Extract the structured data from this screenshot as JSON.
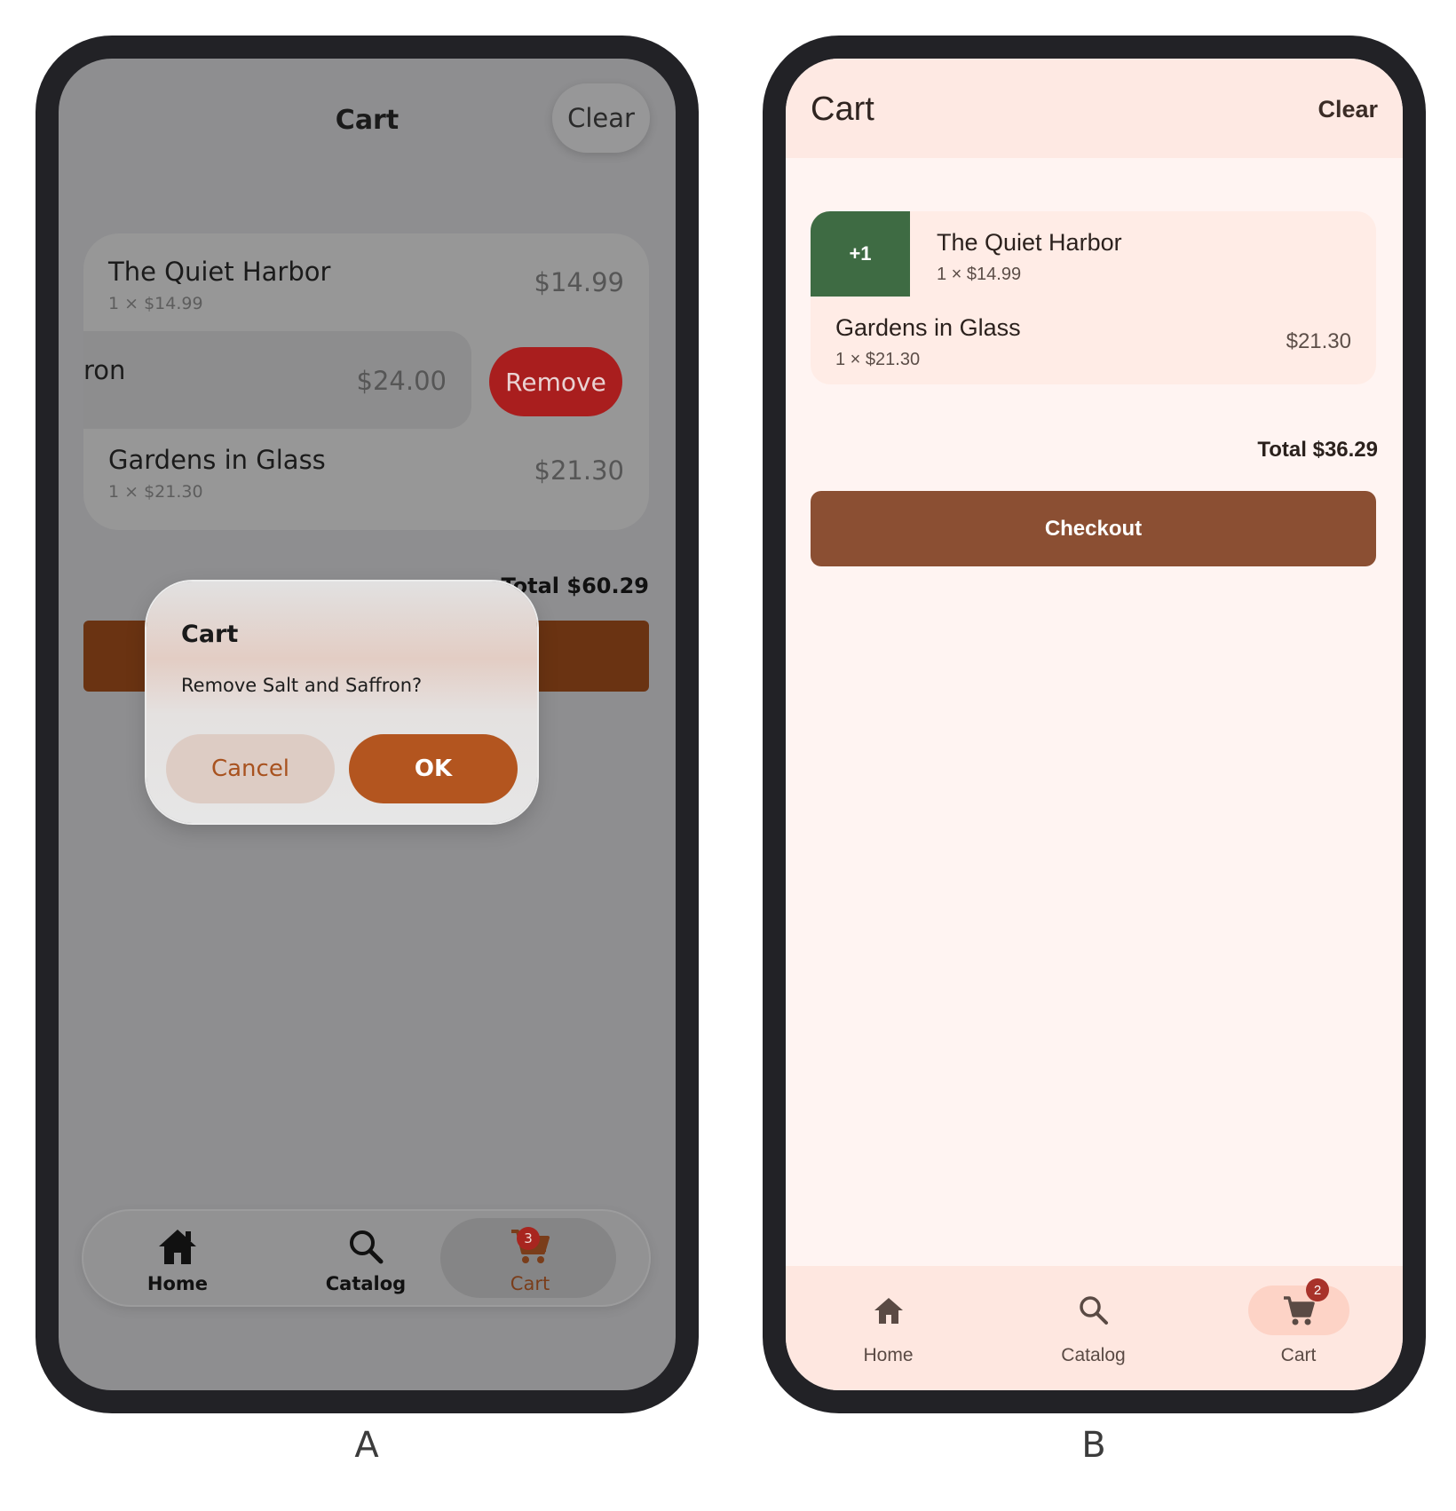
{
  "captions": {
    "a": "A",
    "b": "B"
  },
  "phone_a": {
    "title": "Cart",
    "clear_label": "Clear",
    "items": [
      {
        "name": "The Quiet Harbor",
        "detail": "1 × $14.99",
        "price": "$14.99"
      },
      {
        "name": "ron",
        "price": "$24.00"
      },
      {
        "name": "Gardens in Glass",
        "detail": "1 × $21.30",
        "price": "$21.30"
      }
    ],
    "remove_label": "Remove",
    "total": "Total $60.29",
    "dialog": {
      "title": "Cart",
      "message": "Remove Salt and Saffron?",
      "cancel_label": "Cancel",
      "ok_label": "OK"
    },
    "nav": {
      "tabs": [
        {
          "label": "Home",
          "icon": "home-icon"
        },
        {
          "label": "Catalog",
          "icon": "search-icon"
        },
        {
          "label": "Cart",
          "icon": "cart-icon"
        }
      ],
      "selected": "Cart",
      "cart_badge": "3"
    },
    "colors": {
      "accent": "#b3551f",
      "danger": "#a91e1e",
      "scrim": "#8e8e90"
    }
  },
  "phone_b": {
    "title": "Cart",
    "clear_label": "Clear",
    "undo_label": "+1",
    "items": [
      {
        "name": "The Quiet Harbor",
        "detail": "1 × $14.99"
      },
      {
        "name": "Gardens in Glass",
        "detail": "1 × $21.30",
        "price": "$21.30"
      }
    ],
    "total": "Total $36.29",
    "checkout_label": "Checkout",
    "nav": {
      "tabs": [
        {
          "label": "Home",
          "icon": "home-icon"
        },
        {
          "label": "Catalog",
          "icon": "search-icon"
        },
        {
          "label": "Cart",
          "icon": "cart-icon"
        }
      ],
      "selected": "Cart",
      "cart_badge": "2"
    },
    "colors": {
      "primary": "#8b4f33",
      "undo_green": "#3e6b43",
      "surface": "#fff4f2"
    }
  }
}
